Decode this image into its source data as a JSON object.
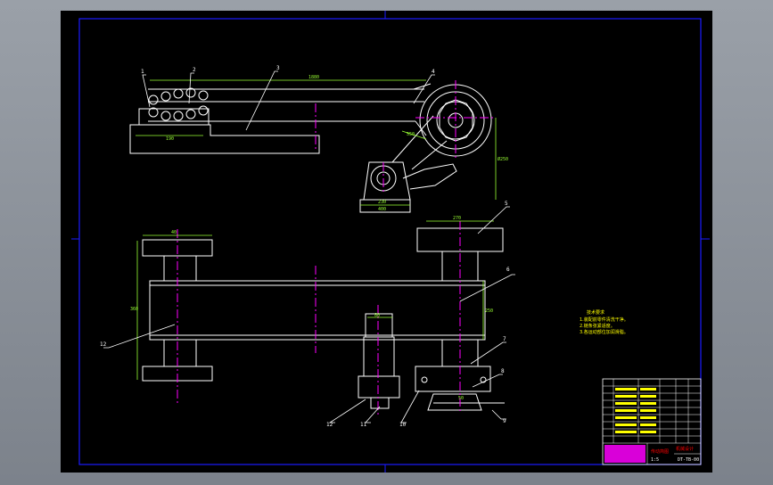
{
  "drawing": {
    "colors": {
      "background": "#000000",
      "frame": "#1c1cff",
      "outline": "#ffffff",
      "center_line": "#ff00ff",
      "dimension": "#99ff33",
      "leader": "#ffff00",
      "note": "#ffff00",
      "title_block_text": "#ff0000"
    },
    "balloons": [
      "1",
      "2",
      "3",
      "4",
      "5",
      "6",
      "7",
      "8",
      "9",
      "10",
      "11",
      "12"
    ],
    "dimensions": {
      "top_length": "1880",
      "base_width": "190",
      "chain_label": "550",
      "motor_base": "230",
      "motor_base_2": "400",
      "sprocket_dia": "Ø250",
      "left_wheel_width": "40",
      "left_height": "360",
      "right_wheel_width": "270",
      "right_height": "250",
      "motor_top": "80",
      "small_dim": "50"
    },
    "notes": {
      "heading": "技术要求",
      "lines": [
        "1.装配前零件清洗干净。",
        "2.链条张紧适度。",
        "3.各运动部位加润滑脂。"
      ]
    },
    "title_block": {
      "title": "传动简图",
      "code": "DT-TB-00",
      "company": "机械设计",
      "scale": "1:5"
    }
  }
}
